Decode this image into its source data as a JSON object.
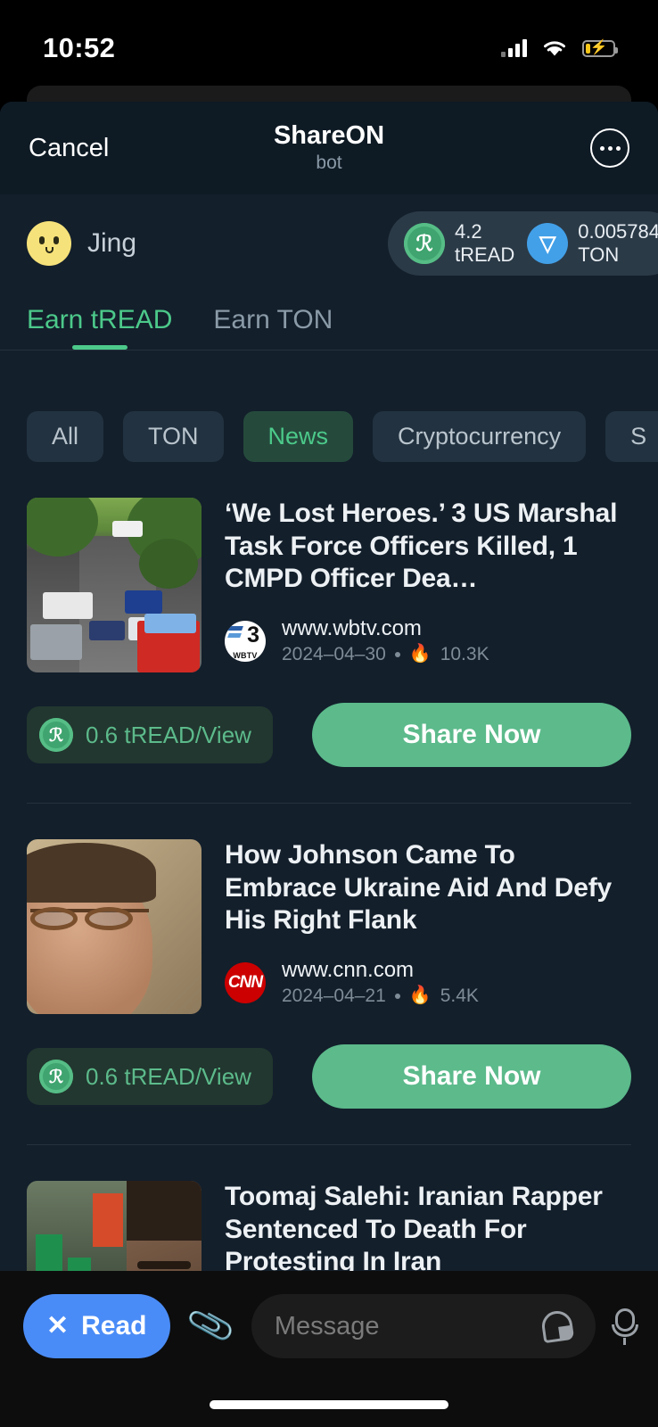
{
  "status_bar": {
    "time": "10:52",
    "signal_icon": "cellular-bars-icon",
    "wifi_icon": "wifi-icon",
    "battery_icon": "battery-charging-icon"
  },
  "nav": {
    "cancel_label": "Cancel",
    "title": "ShareON",
    "subtitle": "bot",
    "more_icon": "more-options-icon"
  },
  "account": {
    "avatar_icon": "user-avatar-icon",
    "username": "Jing",
    "balances": [
      {
        "icon": "tread-coin-icon",
        "amount": "4.2",
        "symbol": "tREAD",
        "color": "#3fa46f"
      },
      {
        "icon": "ton-coin-icon",
        "amount": "0.005784",
        "symbol": "TON",
        "color": "#42a0e8"
      }
    ]
  },
  "tabs": [
    {
      "label": "Earn tREAD",
      "active": true
    },
    {
      "label": "Earn TON",
      "active": false
    }
  ],
  "chips": [
    {
      "label": "All",
      "active": false
    },
    {
      "label": "TON",
      "active": false
    },
    {
      "label": "News",
      "active": true
    },
    {
      "label": "Cryptocurrency",
      "active": false
    },
    {
      "label": "S",
      "active": false
    }
  ],
  "theme": {
    "accent_green": "#4cc98a",
    "share_button_green": "#5cba8b",
    "read_pill_blue": "#4a8cf7",
    "page_background": "#131f2b",
    "navbar_background": "#0e1a24"
  },
  "articles": [
    {
      "thumbnail": "street-police-scene-photo",
      "headline": "‘We Lost Heroes.’ 3 US Marshal Task Force Officers Killed, 1 CMPD Officer Dea…",
      "favicon": "wbtv-logo-icon",
      "source": "www.wbtv.com",
      "date": "2024–04–30",
      "trending_icon": "flame-icon",
      "views": "10.3K",
      "reward": "0.6 tREAD/View",
      "share_label": "Share Now"
    },
    {
      "thumbnail": "mike-johnson-portrait-photo",
      "headline": "How Johnson Came To Embrace Ukraine Aid And Defy His Right Flank",
      "favicon": "cnn-logo-icon",
      "source": "www.cnn.com",
      "date": "2024–04–21",
      "trending_icon": "flame-icon",
      "views": "5.4K",
      "reward": "0.6 tREAD/View",
      "share_label": "Share Now"
    },
    {
      "thumbnail": "iran-protest-rapper-photo",
      "headline": "Toomaj Salehi: Iranian Rapper Sentenced To Death For Protesting In Iran",
      "favicon": "",
      "source": "",
      "date": "",
      "trending_icon": "",
      "views": "",
      "reward": "",
      "share_label": ""
    }
  ],
  "composer": {
    "read_close_icon": "close-icon",
    "read_label": "Read",
    "attach_icon": "paperclip-icon",
    "message_placeholder": "Message",
    "sticker_icon": "sticker-icon",
    "mic_icon": "microphone-icon"
  }
}
